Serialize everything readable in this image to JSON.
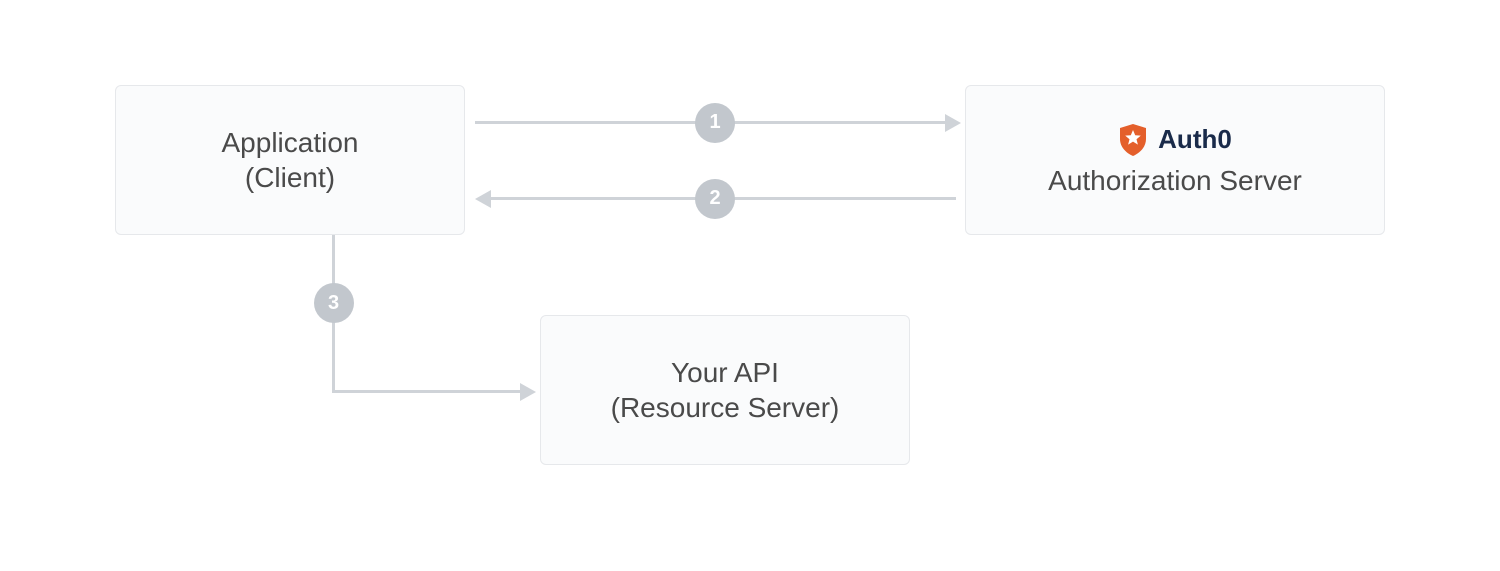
{
  "nodes": {
    "client": {
      "line1": "Application",
      "line2": "(Client)"
    },
    "auth_server": {
      "brand": "Auth0",
      "line1": "Authorization Server"
    },
    "api": {
      "line1": "Your API",
      "line2": "(Resource Server)"
    }
  },
  "steps": {
    "one": "1",
    "two": "2",
    "three": "3"
  },
  "icons": {
    "shield": "auth0-shield"
  }
}
